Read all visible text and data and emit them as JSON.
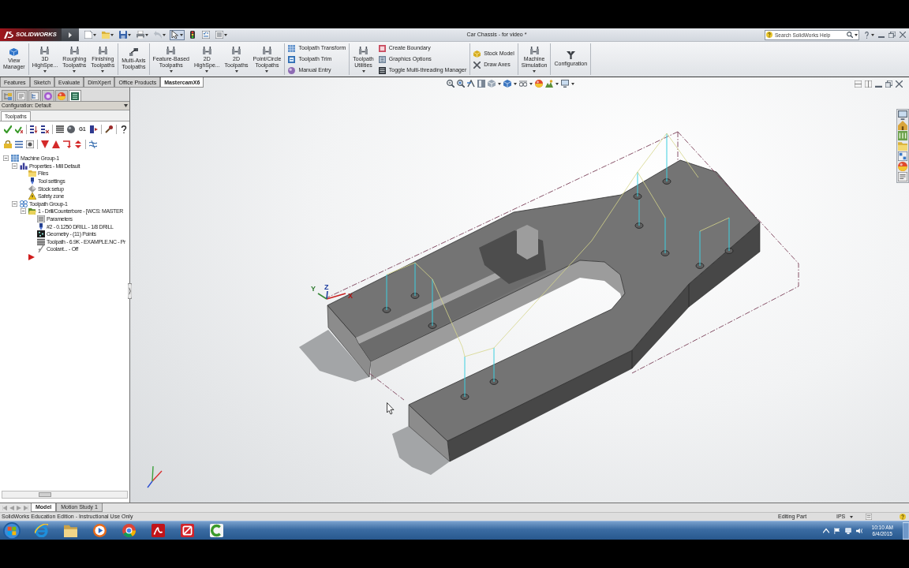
{
  "title_bar": {
    "logo": "SOLIDWORKS",
    "document_title": "Car Chassis - for video *",
    "undo_disabled": true,
    "select_pressed": true,
    "search": {
      "placeholder": "Search SolidWorks Help"
    }
  },
  "ribbon": {
    "groups": [
      {
        "items": [
          {
            "kind": "large",
            "lines": [
              "View",
              "Manager"
            ],
            "dropdown": false
          }
        ]
      },
      {
        "items": [
          {
            "kind": "large",
            "lines": [
              "3D",
              "HighSpe..."
            ],
            "dropdown": true
          },
          {
            "kind": "large",
            "lines": [
              "Roughing",
              "Toolpaths"
            ],
            "dropdown": true
          },
          {
            "kind": "large",
            "lines": [
              "Finishing",
              "Toolpaths"
            ],
            "dropdown": true
          }
        ]
      },
      {
        "items": [
          {
            "kind": "large",
            "lines": [
              "Multi-Axis",
              "Toolpaths"
            ],
            "dropdown": false
          }
        ]
      },
      {
        "items": [
          {
            "kind": "large",
            "lines": [
              "Feature-Based",
              "Toolpaths"
            ],
            "dropdown": true
          },
          {
            "kind": "large",
            "lines": [
              "2D",
              "HighSpe..."
            ],
            "dropdown": true
          },
          {
            "kind": "large",
            "lines": [
              "2D",
              "Toolpaths"
            ],
            "dropdown": true
          },
          {
            "kind": "large",
            "lines": [
              "Point/Circle",
              "Toolpaths"
            ],
            "dropdown": true
          }
        ]
      },
      {
        "items": [
          {
            "kind": "small",
            "label": "Toolpath Transform"
          },
          {
            "kind": "small",
            "label": "Toolpath Trim"
          },
          {
            "kind": "small",
            "label": "Manual Entry"
          }
        ]
      },
      {
        "items": [
          {
            "kind": "large",
            "lines": [
              "Toolpath",
              "Utilities"
            ],
            "dropdown": true
          },
          {
            "kind": "small",
            "label": "Create Boundary"
          },
          {
            "kind": "small",
            "label": "Graphics Options"
          },
          {
            "kind": "small",
            "label": "Toggle Multi-threading Manager"
          }
        ]
      },
      {
        "items": [
          {
            "kind": "small",
            "label": "Stock Model"
          },
          {
            "kind": "small",
            "label": "Draw Axes"
          }
        ]
      },
      {
        "items": [
          {
            "kind": "large",
            "lines": [
              "Machine",
              "Simulation"
            ],
            "dropdown": true
          }
        ]
      },
      {
        "items": [
          {
            "kind": "large",
            "lines": [
              "Configuration"
            ],
            "dropdown": false
          }
        ]
      }
    ]
  },
  "command_tabs": [
    {
      "label": "Features",
      "selected": false
    },
    {
      "label": "Sketch",
      "selected": false
    },
    {
      "label": "Evaluate",
      "selected": false
    },
    {
      "label": "DimXpert",
      "selected": false
    },
    {
      "label": "Office Products",
      "selected": false
    },
    {
      "label": "MastercamX6",
      "selected": true
    }
  ],
  "feature_manager": {
    "tabs": [
      {
        "selected": false
      },
      {
        "selected": false
      },
      {
        "selected": false
      },
      {
        "selected": false
      },
      {
        "selected": false
      },
      {
        "selected": true
      }
    ],
    "configuration": "Configuration: Default",
    "panel_tabs": [
      {
        "label": "Toolpaths",
        "selected": true
      }
    ],
    "toolbar_text_button": "G1",
    "tree": [
      {
        "label": "Machine Group-1",
        "kind": "machine-group",
        "expanded": true,
        "children": [
          {
            "label": "Properties - Mill Default",
            "kind": "properties",
            "expanded": true,
            "children": [
              {
                "label": "Files",
                "kind": "files"
              },
              {
                "label": "Tool settings",
                "kind": "tool"
              },
              {
                "label": "Stock setup",
                "kind": "stock"
              },
              {
                "label": "Safety zone",
                "kind": "safety"
              }
            ]
          },
          {
            "label": "Toolpath Group-1",
            "kind": "toolpath-group",
            "expanded": true,
            "children": [
              {
                "label": "1 - Drill/Counterbore - [WCS: MASTER",
                "kind": "operation",
                "expanded": true,
                "children": [
                  {
                    "label": "Parameters",
                    "kind": "parameters"
                  },
                  {
                    "label": "#2 - 0.1250 DRILL - 1/8 DRILL",
                    "kind": "tool"
                  },
                  {
                    "label": "Geometry - (11) Points",
                    "kind": "geometry"
                  },
                  {
                    "label": "Toolpath - 6.9K - EXAMPLE.NC - Pr",
                    "kind": "toolpath"
                  },
                  {
                    "label": "Coolant... - Off",
                    "kind": "coolant"
                  }
                ]
              }
            ]
          }
        ]
      }
    ]
  },
  "viewport": {
    "triad_labels": {
      "y": "Y",
      "z": "Z",
      "x": "X"
    }
  },
  "model_tabs": [
    {
      "label": "Model",
      "selected": true
    },
    {
      "label": "Motion Study 1",
      "selected": false
    }
  ],
  "status_bar": {
    "message": "SolidWorks Education Edition - Instructional Use Only",
    "mode": "Editing Part",
    "units": "IPS"
  },
  "taskbar": {
    "time": "10:10 AM",
    "date": "6/4/2015"
  }
}
